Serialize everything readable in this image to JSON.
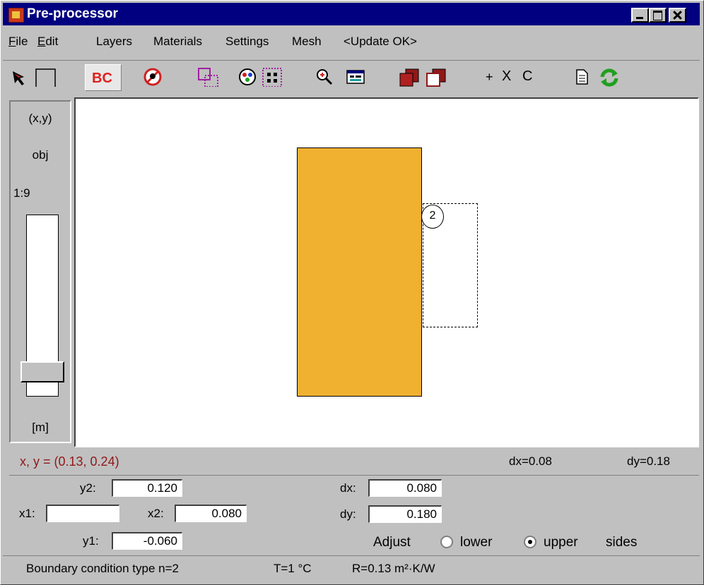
{
  "window": {
    "title": "Pre-processor"
  },
  "menu": {
    "items": [
      "File",
      "Edit",
      "Layers",
      "Materials",
      "Settings",
      "Mesh",
      "<Update OK>"
    ]
  },
  "toolbar": {
    "bc_label": "BC",
    "plus_label": "+",
    "x_label": "X",
    "c_label": "C"
  },
  "side": {
    "coords_label": "(x,y)",
    "obj_label": "obj",
    "scale_label": "1:9",
    "unit_label": "[m]"
  },
  "canvas": {
    "marker_label": "2"
  },
  "status": {
    "coords": "x, y = (0.13,  0.24)",
    "dx": "dx=0.08",
    "dy": "dy=0.18"
  },
  "editor": {
    "y2_label": "y2:",
    "y2_value": "0.120",
    "x1_label": "x1:",
    "x1_value": "",
    "x2_label": "x2:",
    "x2_value": "0.080",
    "y1_label": "y1:",
    "y1_value": "-0.060",
    "dx_label": "dx:",
    "dx_value": "0.080",
    "dy_label": "dy:",
    "dy_value": "0.180",
    "adjust_label": "Adjust",
    "lower_label": "lower",
    "upper_label": "upper",
    "sides_label": "sides",
    "selected_side": "upper"
  },
  "footer": {
    "bc_type": "Boundary condition type n=2",
    "temperature": "T=1 °C",
    "resistance": "R=0.13 m²·K/W"
  },
  "colors": {
    "title_bar": "#000080",
    "material_fill": "#f0b030",
    "coords_text": "#901818",
    "refresh_icon": "#20a020",
    "bc_text": "#e02020"
  }
}
